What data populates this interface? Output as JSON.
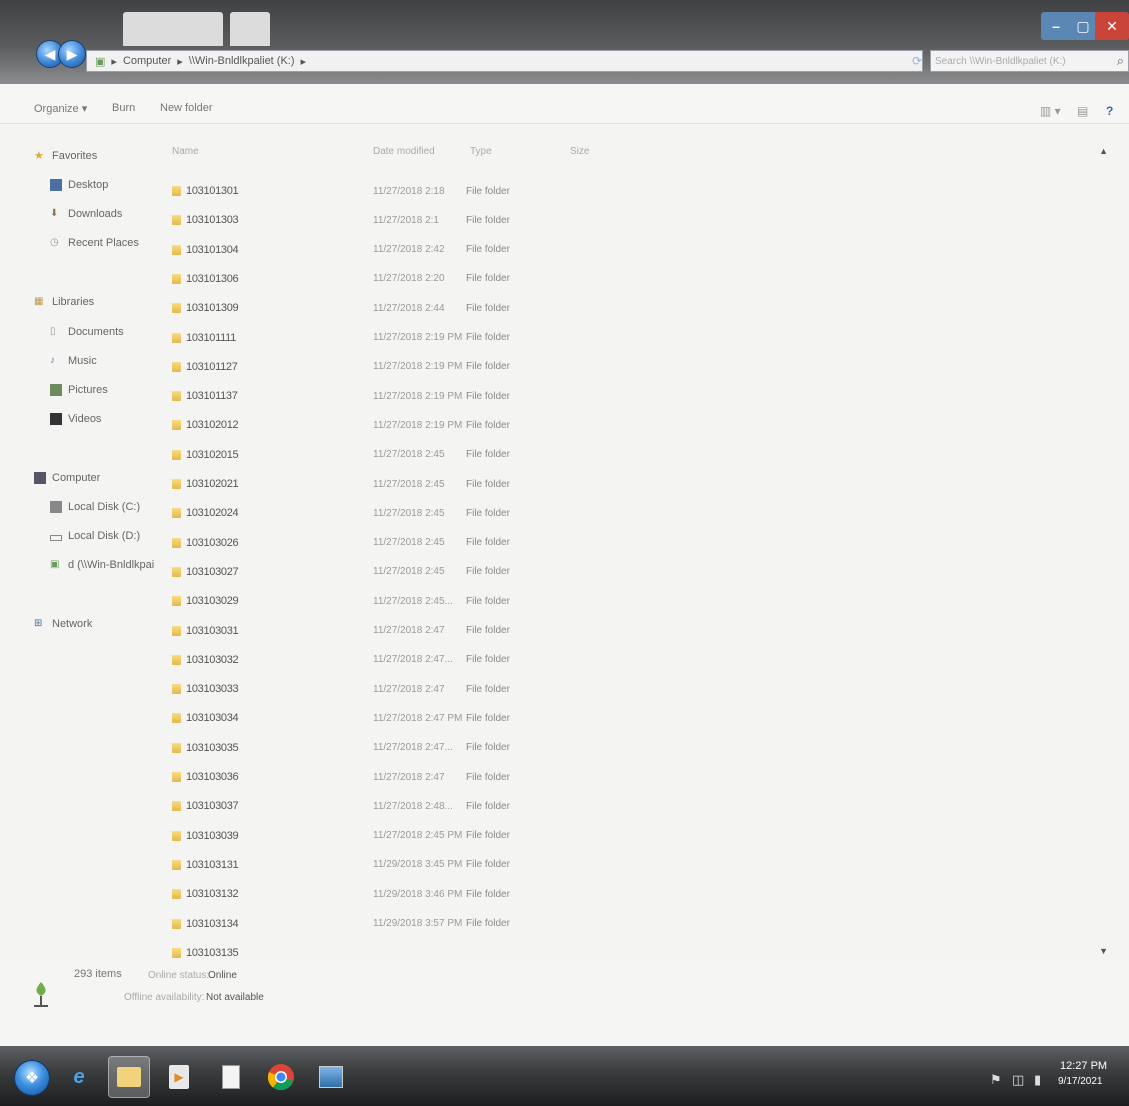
{
  "addressbar": {
    "segments": [
      "Computer",
      "\\\\Win-Bnldlkpaliet (K:)"
    ],
    "search_placeholder": "Search \\\\Win-Bnldlkpaliet (K:)"
  },
  "window_controls": {
    "minimize": "–",
    "maximize": "▢",
    "close": "✕"
  },
  "toolbar": {
    "organize_label": "Organize ▾",
    "burn_label": "Burn",
    "new_folder_label": "New folder"
  },
  "nav": {
    "favorites": "Favorites",
    "desktop": "Desktop",
    "downloads": "Downloads",
    "recent_places": "Recent Places",
    "libraries": "Libraries",
    "documents": "Documents",
    "music": "Music",
    "pictures": "Pictures",
    "videos": "Videos",
    "computer": "Computer",
    "local_disk_c": "Local Disk (C:)",
    "local_disk_d": "Local Disk (D:)",
    "network_drive": "d (\\\\Win-Bnldlkpai",
    "network": "Network"
  },
  "columns": {
    "name": "Name",
    "date": "Date modified",
    "type": "Type",
    "size": "Size"
  },
  "files": [
    {
      "name": "103101301",
      "date": "11/27/2018 2:18",
      "type": "File folder"
    },
    {
      "name": "103101303",
      "date": "11/27/2018 2:1",
      "type": "File folder"
    },
    {
      "name": "103101304",
      "date": "11/27/2018 2:42",
      "type": "File folder"
    },
    {
      "name": "103101306",
      "date": "11/27/2018 2:20",
      "type": "File folder"
    },
    {
      "name": "103101309",
      "date": "11/27/2018 2:44",
      "type": "File folder"
    },
    {
      "name": "103101111",
      "date": "11/27/2018 2:19 PM",
      "type": "File folder"
    },
    {
      "name": "103101127",
      "date": "11/27/2018 2:19 PM",
      "type": "File folder"
    },
    {
      "name": "103101137",
      "date": "11/27/2018 2:19 PM",
      "type": "File folder"
    },
    {
      "name": "103102012",
      "date": "11/27/2018 2:19 PM",
      "type": "File folder"
    },
    {
      "name": "103102015",
      "date": "11/27/2018 2:45",
      "type": "File folder"
    },
    {
      "name": "103102021",
      "date": "11/27/2018 2:45",
      "type": "File folder"
    },
    {
      "name": "103102024",
      "date": "11/27/2018 2:45",
      "type": "File folder"
    },
    {
      "name": "103103026",
      "date": "11/27/2018 2:45",
      "type": "File folder"
    },
    {
      "name": "103103027",
      "date": "11/27/2018 2:45",
      "type": "File folder"
    },
    {
      "name": "103103029",
      "date": "11/27/2018 2:45...",
      "type": "File folder"
    },
    {
      "name": "103103031",
      "date": "11/27/2018 2:47",
      "type": "File folder"
    },
    {
      "name": "103103032",
      "date": "11/27/2018 2:47...",
      "type": "File folder"
    },
    {
      "name": "103103033",
      "date": "11/27/2018 2:47",
      "type": "File folder"
    },
    {
      "name": "103103034",
      "date": "11/27/2018 2:47 PM",
      "type": "File folder"
    },
    {
      "name": "103103035",
      "date": "11/27/2018 2:47...",
      "type": "File folder"
    },
    {
      "name": "103103036",
      "date": "11/27/2018 2:47",
      "type": "File folder"
    },
    {
      "name": "103103037",
      "date": "11/27/2018 2:48...",
      "type": "File folder"
    },
    {
      "name": "103103039",
      "date": "11/27/2018 2:45 PM",
      "type": "File folder"
    },
    {
      "name": "103103131",
      "date": "11/29/2018 3:45 PM",
      "type": "File folder"
    },
    {
      "name": "103103132",
      "date": "11/29/2018 3:46 PM",
      "type": "File folder"
    },
    {
      "name": "103103134",
      "date": "11/29/2018 3:57 PM",
      "type": "File folder"
    },
    {
      "name": "103103135",
      "date": "",
      "type": ""
    }
  ],
  "details": {
    "item_count": "293 items",
    "status_label": "Online status:",
    "status_value": "Online",
    "offline_label": "Offline availability:",
    "offline_value": "Not available"
  },
  "clock": {
    "time": "12:27 PM",
    "date": "9/17/2021"
  },
  "colors": {
    "taskbar": "#1d1e20",
    "titlebar": "#3f4143",
    "folder": "#e6b84a"
  }
}
